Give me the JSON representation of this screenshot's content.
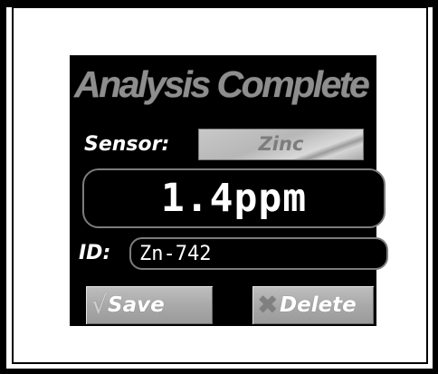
{
  "screen": {
    "title": "Analysis Complete",
    "sensor": {
      "label": "Sensor:",
      "value": "Zinc"
    },
    "reading": {
      "value": "1.4ppm"
    },
    "id_field": {
      "label": "ID:",
      "value": "Zn-742"
    },
    "buttons": {
      "save_label": "Save",
      "save_icon": "checkmark-icon",
      "delete_label": "Delete",
      "delete_icon": "x-icon"
    }
  },
  "colors": {
    "screen_background": "#000000",
    "title_text": "#8e8e8e",
    "text": "#ffffff",
    "chip": "#c0c0c0",
    "field_border": "#7c7c7c"
  }
}
